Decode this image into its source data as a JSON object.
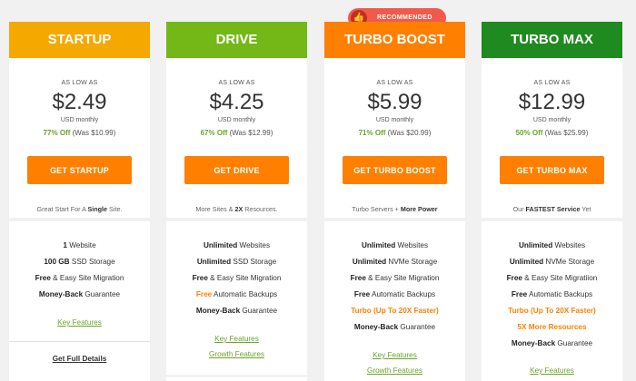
{
  "plans": [
    {
      "name": "STARTUP",
      "color": "#f5a800",
      "as_low_as": "AS LOW AS",
      "price": "$2.49",
      "billing": "USD monthly",
      "discount_pct": "77% Off",
      "was": "(Was $10.99)",
      "button": "GET STARTUP",
      "tagline_pre": "Great Start For A ",
      "tagline_bold": "Single",
      "tagline_post": " Site.",
      "features": [
        {
          "bold": "1",
          "rest": " Website"
        },
        {
          "bold": "100 GB",
          "rest": " SSD Storage"
        },
        {
          "bold": "Free",
          "rest": " & Easy Site Migration"
        },
        {
          "bold": "Money-Back",
          "rest": " Guarantee"
        }
      ],
      "key_features": "Key Features",
      "full_details": "Get Full Details"
    },
    {
      "name": "DRIVE",
      "color": "#73b816",
      "as_low_as": "AS LOW AS",
      "price": "$4.25",
      "billing": "USD monthly",
      "discount_pct": "67% Off",
      "was": "(Was $12.99)",
      "button": "GET DRIVE",
      "tagline_pre": "More Sites & ",
      "tagline_bold": "2X",
      "tagline_post": " Resources.",
      "features": [
        {
          "bold": "Unlimited",
          "rest": " Websites"
        },
        {
          "bold": "Unlimited",
          "rest": " SSD Storage"
        },
        {
          "bold": "Free",
          "rest": " & Easy Site Migration"
        },
        {
          "orange": "Free",
          "rest": " Automatic Backups"
        },
        {
          "bold": "Money-Back",
          "rest": " Guarantee"
        }
      ],
      "key_features": "Key Features",
      "growth_features": "Growth Features"
    },
    {
      "name": "TURBO BOOST",
      "color": "#ff7f00",
      "as_low_as": "AS LOW AS",
      "price": "$5.99",
      "billing": "USD monthly",
      "discount_pct": "71% Off",
      "was": "(Was $20.99)",
      "button": "GET TURBO BOOST",
      "tagline_pre": "Turbo Servers + ",
      "tagline_bold": "More Power",
      "tagline_post": "",
      "features": [
        {
          "bold": "Unlimited",
          "rest": " Websites"
        },
        {
          "bold": "Unlimited",
          "rest": " NVMe Storage"
        },
        {
          "bold": "Free",
          "rest": " & Easy Site Migration"
        },
        {
          "bold": "Free",
          "rest": " Automatic Backups"
        },
        {
          "orange": "Turbo (Up To 20X Faster)"
        },
        {
          "bold": "Money-Back",
          "rest": " Guarantee"
        }
      ],
      "key_features": "Key Features",
      "growth_features": "Growth Features"
    },
    {
      "name": "TURBO MAX",
      "color": "#1f8a1f",
      "as_low_as": "AS LOW AS",
      "price": "$12.99",
      "billing": "USD monthly",
      "discount_pct": "50% Off",
      "was": "(Was $25.99)",
      "button": "GET TURBO MAX",
      "tagline_pre": "Our ",
      "tagline_bold": "FASTEST Service",
      "tagline_post": " Yet",
      "features": [
        {
          "bold": "Unlimited",
          "rest": " Websites"
        },
        {
          "bold": "Unlimited",
          "rest": " NVMe Storage"
        },
        {
          "bold": "Free",
          "rest": " & Easy Site Migratiion"
        },
        {
          "bold": "Free",
          "rest": " Automatic Backups"
        },
        {
          "orange": "Turbo (Up To 20X Faster)"
        },
        {
          "orange": "5X More Resources"
        },
        {
          "bold": "Money-Back",
          "rest": " Guarantee"
        }
      ],
      "key_features": "Key Features"
    }
  ],
  "badge": {
    "label": "RECOMMENDED",
    "icon": "thumbs-up-icon"
  }
}
